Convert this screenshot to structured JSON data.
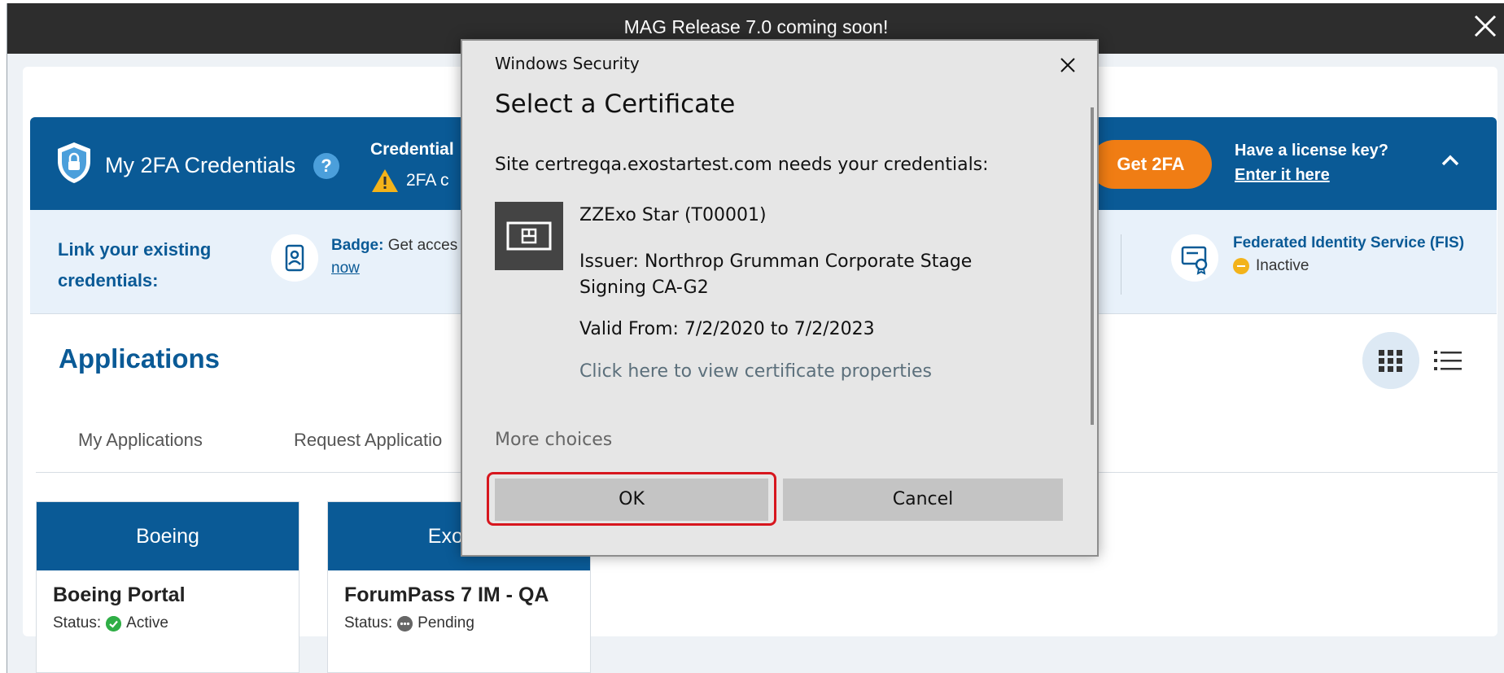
{
  "banner": {
    "text": "MAG Release 7.0 coming soon!",
    "close_icon": "close-icon"
  },
  "tfa": {
    "title": "My 2FA Credentials",
    "help_glyph": "?",
    "credential_label": "Credential",
    "warning_text": "2FA c",
    "get_button": "Get 2FA",
    "license_question": "Have a license key?",
    "license_link": "Enter it here"
  },
  "link_strip": {
    "title": "Link your existing credentials:",
    "badge_label": "Badge:",
    "badge_text": "Get acces",
    "badge_link": "now",
    "fis_title": "Federated Identity Service (FIS)",
    "fis_status": "Inactive"
  },
  "applications": {
    "title": "Applications",
    "tabs": [
      "My Applications",
      "Request Applicatio"
    ],
    "cards": [
      {
        "header": "Boeing",
        "name": "Boeing Portal",
        "status_label": "Status:",
        "status": "Active"
      },
      {
        "header": "Exosta",
        "name": "ForumPass 7 IM - QA",
        "status_label": "Status:",
        "status": "Pending"
      }
    ]
  },
  "dialog": {
    "caption": "Windows Security",
    "heading": "Select a Certificate",
    "site_message": "Site certregqa.exostartest.com needs your credentials:",
    "cert_name": "ZZExo Star (T00001)",
    "cert_issuer": "Issuer: Northrop Grumman Corporate Stage Signing CA-G2",
    "cert_valid": "Valid From: 7/2/2020 to 7/2/2023",
    "cert_props_link": "Click here to view certificate properties",
    "more_choices": "More choices",
    "ok_label": "OK",
    "cancel_label": "Cancel"
  },
  "colors": {
    "brand_blue": "#0a5a96",
    "accent_orange": "#f07d14",
    "banner_dark": "#2d2d2d",
    "highlight_red": "#d7161e",
    "status_active": "#2fae46",
    "status_inactive": "#f3b31a"
  }
}
